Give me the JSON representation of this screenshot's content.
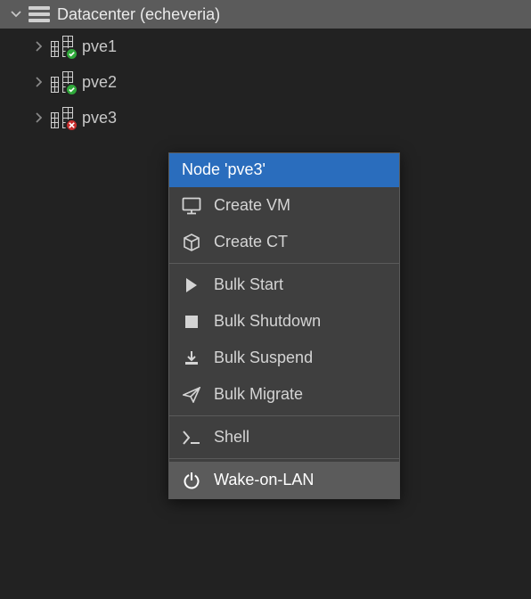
{
  "tree": {
    "root_label": "Datacenter (echeveria)",
    "nodes": [
      {
        "name": "pve1",
        "status": "ok"
      },
      {
        "name": "pve2",
        "status": "ok"
      },
      {
        "name": "pve3",
        "status": "error"
      }
    ]
  },
  "context_menu": {
    "header": "Node 'pve3'",
    "items": {
      "create_vm": "Create VM",
      "create_ct": "Create CT",
      "bulk_start": "Bulk Start",
      "bulk_shutdown": "Bulk Shutdown",
      "bulk_suspend": "Bulk Suspend",
      "bulk_migrate": "Bulk Migrate",
      "shell": "Shell",
      "wake_on_lan": "Wake-on-LAN"
    }
  }
}
